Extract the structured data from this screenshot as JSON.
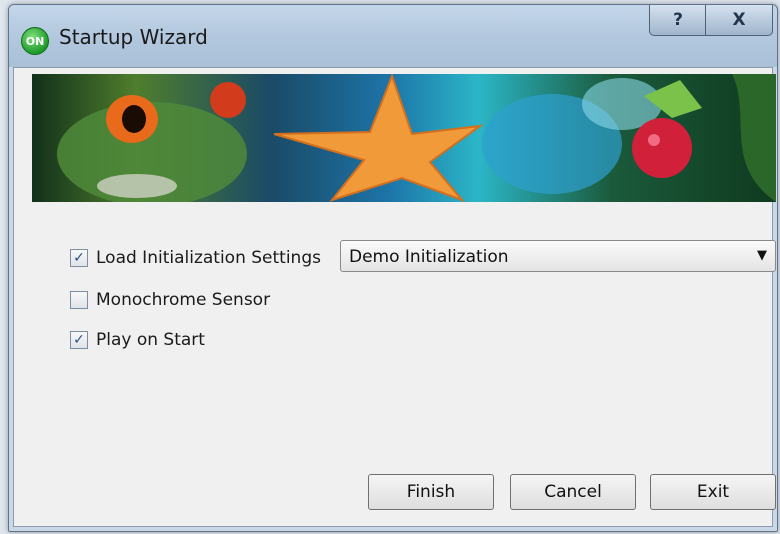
{
  "window": {
    "title": "Startup Wizard",
    "app_icon_text": "ON",
    "help_glyph": "?",
    "close_glyph": "X"
  },
  "options": [
    {
      "label": "Load Initialization Settings",
      "checked": true
    },
    {
      "label": "Monochrome Sensor",
      "checked": false
    },
    {
      "label": "Play on Start",
      "checked": true
    }
  ],
  "init_select": {
    "selected": "Demo Initialization"
  },
  "buttons": {
    "finish": "Finish",
    "cancel": "Cancel",
    "exit": "Exit"
  },
  "icons": {
    "app": "on-semiconductor-logo-icon",
    "help": "help-icon",
    "close": "close-icon",
    "dropdown": "dropdown-arrow-icon",
    "check": "check-icon"
  },
  "colors": {
    "check": "#2e4a86",
    "titlebar": "#b3c8de"
  }
}
